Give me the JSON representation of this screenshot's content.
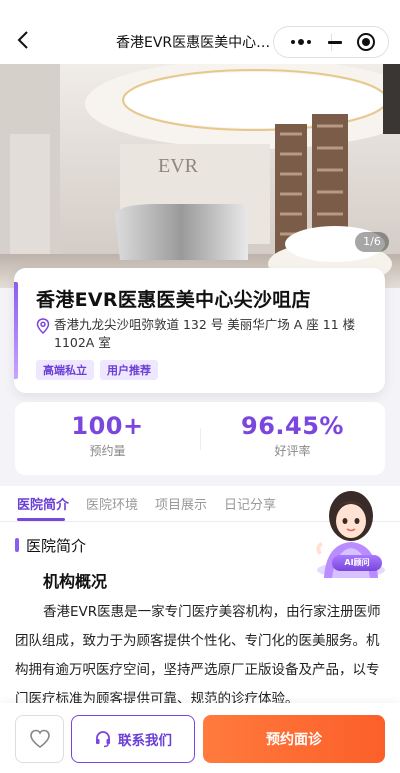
{
  "nav": {
    "title": "香港EVR医惠医美中心尖沙咀店"
  },
  "hero": {
    "counter": "1/6",
    "sign_text": "EVR"
  },
  "store": {
    "name": "香港EVR医惠医美中心尖沙咀店",
    "address": "香港九龙尖沙咀弥敦道 132 号 美丽华广场 A 座 11 楼 1102A 室",
    "tags": [
      "高端私立",
      "用户推荐"
    ]
  },
  "stats": {
    "bookings_value": "100+",
    "bookings_label": "预约量",
    "rating_value": "96.45%",
    "rating_label": "好评率"
  },
  "tabs": [
    "医院简介",
    "医院环境",
    "项目展示",
    "日记分享"
  ],
  "ai": {
    "badge": "AI顾问"
  },
  "intro": {
    "section_title": "医院简介",
    "subtitle": "机构概况",
    "body": "香港EVR医惠是一家专门医疗美容机构，由行家注册医师团队组成，致力于为顾客提供个性化、专门化的医美服务。机构拥有逾万呎医疗空间，坚持严选原厂正版设备及产品，以专门医疗标准为顾客提供可靠、规范的诊疗体验。"
  },
  "bottom": {
    "contact_label": "联系我们",
    "book_label": "预约面诊"
  },
  "colors": {
    "accent": "#7a46dd",
    "cta": "#fc5f2a"
  }
}
